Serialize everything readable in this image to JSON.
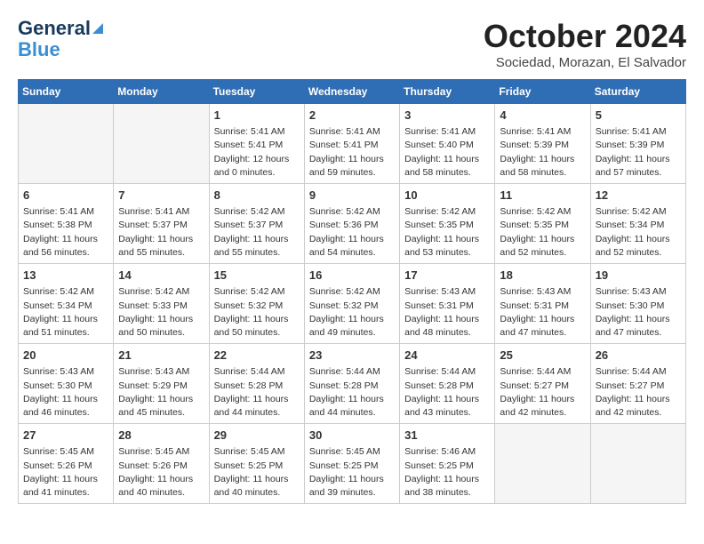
{
  "header": {
    "logo_general": "General",
    "logo_blue": "Blue",
    "month_title": "October 2024",
    "subtitle": "Sociedad, Morazan, El Salvador"
  },
  "weekdays": [
    "Sunday",
    "Monday",
    "Tuesday",
    "Wednesday",
    "Thursday",
    "Friday",
    "Saturday"
  ],
  "weeks": [
    [
      {
        "day": "",
        "info": ""
      },
      {
        "day": "",
        "info": ""
      },
      {
        "day": "1",
        "info": "Sunrise: 5:41 AM\nSunset: 5:41 PM\nDaylight: 12 hours\nand 0 minutes."
      },
      {
        "day": "2",
        "info": "Sunrise: 5:41 AM\nSunset: 5:41 PM\nDaylight: 11 hours\nand 59 minutes."
      },
      {
        "day": "3",
        "info": "Sunrise: 5:41 AM\nSunset: 5:40 PM\nDaylight: 11 hours\nand 58 minutes."
      },
      {
        "day": "4",
        "info": "Sunrise: 5:41 AM\nSunset: 5:39 PM\nDaylight: 11 hours\nand 58 minutes."
      },
      {
        "day": "5",
        "info": "Sunrise: 5:41 AM\nSunset: 5:39 PM\nDaylight: 11 hours\nand 57 minutes."
      }
    ],
    [
      {
        "day": "6",
        "info": "Sunrise: 5:41 AM\nSunset: 5:38 PM\nDaylight: 11 hours\nand 56 minutes."
      },
      {
        "day": "7",
        "info": "Sunrise: 5:41 AM\nSunset: 5:37 PM\nDaylight: 11 hours\nand 55 minutes."
      },
      {
        "day": "8",
        "info": "Sunrise: 5:42 AM\nSunset: 5:37 PM\nDaylight: 11 hours\nand 55 minutes."
      },
      {
        "day": "9",
        "info": "Sunrise: 5:42 AM\nSunset: 5:36 PM\nDaylight: 11 hours\nand 54 minutes."
      },
      {
        "day": "10",
        "info": "Sunrise: 5:42 AM\nSunset: 5:35 PM\nDaylight: 11 hours\nand 53 minutes."
      },
      {
        "day": "11",
        "info": "Sunrise: 5:42 AM\nSunset: 5:35 PM\nDaylight: 11 hours\nand 52 minutes."
      },
      {
        "day": "12",
        "info": "Sunrise: 5:42 AM\nSunset: 5:34 PM\nDaylight: 11 hours\nand 52 minutes."
      }
    ],
    [
      {
        "day": "13",
        "info": "Sunrise: 5:42 AM\nSunset: 5:34 PM\nDaylight: 11 hours\nand 51 minutes."
      },
      {
        "day": "14",
        "info": "Sunrise: 5:42 AM\nSunset: 5:33 PM\nDaylight: 11 hours\nand 50 minutes."
      },
      {
        "day": "15",
        "info": "Sunrise: 5:42 AM\nSunset: 5:32 PM\nDaylight: 11 hours\nand 50 minutes."
      },
      {
        "day": "16",
        "info": "Sunrise: 5:42 AM\nSunset: 5:32 PM\nDaylight: 11 hours\nand 49 minutes."
      },
      {
        "day": "17",
        "info": "Sunrise: 5:43 AM\nSunset: 5:31 PM\nDaylight: 11 hours\nand 48 minutes."
      },
      {
        "day": "18",
        "info": "Sunrise: 5:43 AM\nSunset: 5:31 PM\nDaylight: 11 hours\nand 47 minutes."
      },
      {
        "day": "19",
        "info": "Sunrise: 5:43 AM\nSunset: 5:30 PM\nDaylight: 11 hours\nand 47 minutes."
      }
    ],
    [
      {
        "day": "20",
        "info": "Sunrise: 5:43 AM\nSunset: 5:30 PM\nDaylight: 11 hours\nand 46 minutes."
      },
      {
        "day": "21",
        "info": "Sunrise: 5:43 AM\nSunset: 5:29 PM\nDaylight: 11 hours\nand 45 minutes."
      },
      {
        "day": "22",
        "info": "Sunrise: 5:44 AM\nSunset: 5:28 PM\nDaylight: 11 hours\nand 44 minutes."
      },
      {
        "day": "23",
        "info": "Sunrise: 5:44 AM\nSunset: 5:28 PM\nDaylight: 11 hours\nand 44 minutes."
      },
      {
        "day": "24",
        "info": "Sunrise: 5:44 AM\nSunset: 5:28 PM\nDaylight: 11 hours\nand 43 minutes."
      },
      {
        "day": "25",
        "info": "Sunrise: 5:44 AM\nSunset: 5:27 PM\nDaylight: 11 hours\nand 42 minutes."
      },
      {
        "day": "26",
        "info": "Sunrise: 5:44 AM\nSunset: 5:27 PM\nDaylight: 11 hours\nand 42 minutes."
      }
    ],
    [
      {
        "day": "27",
        "info": "Sunrise: 5:45 AM\nSunset: 5:26 PM\nDaylight: 11 hours\nand 41 minutes."
      },
      {
        "day": "28",
        "info": "Sunrise: 5:45 AM\nSunset: 5:26 PM\nDaylight: 11 hours\nand 40 minutes."
      },
      {
        "day": "29",
        "info": "Sunrise: 5:45 AM\nSunset: 5:25 PM\nDaylight: 11 hours\nand 40 minutes."
      },
      {
        "day": "30",
        "info": "Sunrise: 5:45 AM\nSunset: 5:25 PM\nDaylight: 11 hours\nand 39 minutes."
      },
      {
        "day": "31",
        "info": "Sunrise: 5:46 AM\nSunset: 5:25 PM\nDaylight: 11 hours\nand 38 minutes."
      },
      {
        "day": "",
        "info": ""
      },
      {
        "day": "",
        "info": ""
      }
    ]
  ]
}
